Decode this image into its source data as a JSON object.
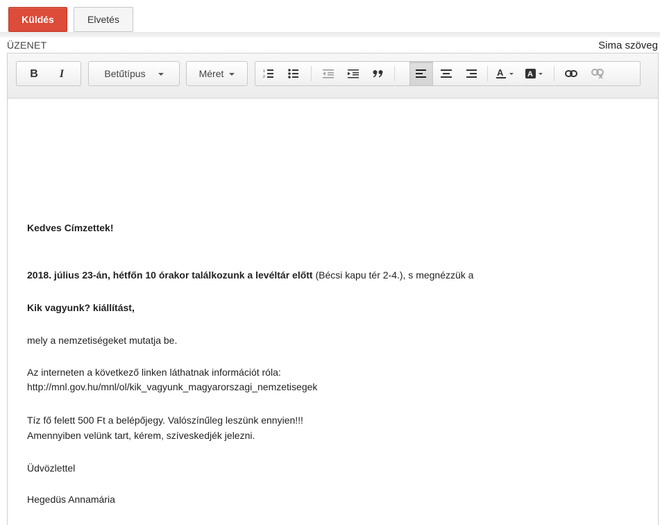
{
  "actions": {
    "send_label": "Küldés",
    "discard_label": "Elvetés"
  },
  "colors": {
    "send_bg": "#dd4b39",
    "accent": "#dd4b39"
  },
  "message_header": {
    "label": "ÜZENET",
    "plain_text_link": "Sima szöveg"
  },
  "toolbar": {
    "bold": "B",
    "italic": "I",
    "font_select": "Betűtípus",
    "size_select": "Méret",
    "icons": [
      "bold-icon",
      "italic-icon",
      "numbered-list-icon",
      "bulleted-list-icon",
      "outdent-icon",
      "indent-icon",
      "quote-icon",
      "align-left-icon",
      "align-center-icon",
      "align-right-icon",
      "text-color-icon",
      "background-color-icon",
      "link-icon",
      "unlink-icon"
    ],
    "active": "align-left"
  },
  "message": {
    "greeting": "Kedves Címzettek!",
    "p1_bold": "2018. július 23-án, hétfőn 10 órakor találkozunk a levéltár előtt",
    "p1_rest": " (Bécsi kapu tér 2-4.), s megnézzük a",
    "exhibit": "Kik vagyunk? kiállítást,",
    "p2": "mely a nemzetiségeket mutatja be.",
    "p3": "Az interneten a következő linken láthatnak információt róla:",
    "link": "http://mnl.gov.hu/mnl/ol/kik_vagyunk_magyarorszagi_nemzetisegek",
    "p4": "Tíz fő felett 500 Ft a belépőjegy. Valószínűleg leszünk ennyien!!!",
    "p5": "Amennyiben velünk tart, kérem, szíveskedjék jelezni.",
    "closing": "Üdvözlettel",
    "signature": "Hegedüs Annamária"
  }
}
